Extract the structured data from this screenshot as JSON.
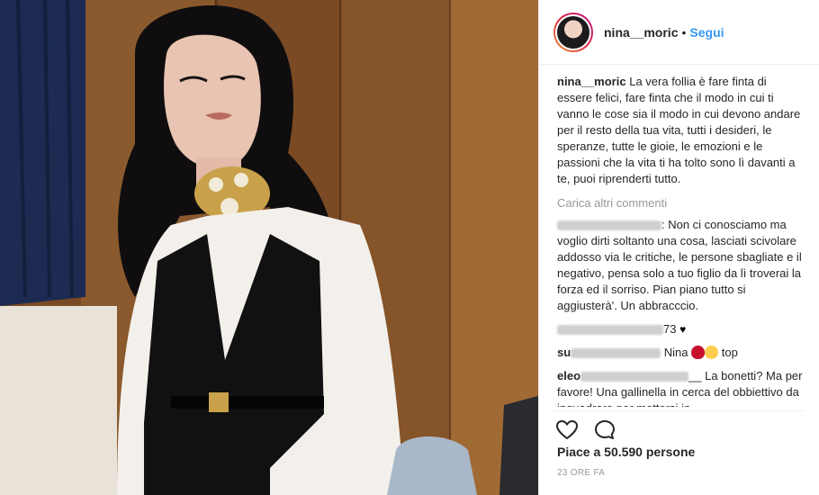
{
  "post": {
    "username": "nina__moric",
    "separator": "•",
    "follow_label": "Segui",
    "caption": "La vera follia è fare finta di essere felici, fare finta che il modo in cui ti vanno le cose sia il modo in cui devono andare per il resto della tua vita, tutti i desideri, le speranze, tutte le gioie, le emozioni e le passioni che la vita ti ha tolto sono lì davanti a te, puoi riprenderti tutto.",
    "load_more_label": "Carica altri commenti",
    "comments": [
      {
        "text": ": Non ci conosciamo ma voglio dirti soltanto una cosa, lasciati scivolare addosso via le critiche, le persone sbagliate e il negativo, pensa solo a tuo figlio da lì troverai la forza ed il sorriso. Pian piano tutto si aggiusterà'. Un abbracccio."
      },
      {
        "text": "73"
      },
      {
        "prefix": "su",
        "text": " Nina",
        "suffix": "top"
      },
      {
        "prefix": "eleo",
        "text": "__ La bonetti? Ma per favore! Una gallinella in cerca del obbiettivo da inquadrare per mettersi in"
      }
    ],
    "likes": "Piace a 50.590 persone",
    "time": "23 ORE FA"
  },
  "icons": {
    "like": "heart-outline-icon",
    "comment": "comment-bubble-icon"
  },
  "colors": {
    "follow": "#3897f0",
    "text": "#262626",
    "muted": "#999999"
  }
}
